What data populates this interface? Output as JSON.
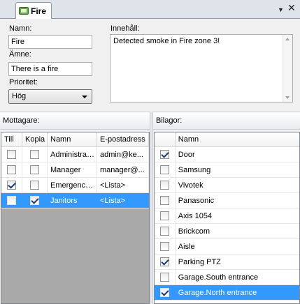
{
  "tab": {
    "title": "Fire",
    "menu_glyph": "▼",
    "close_glyph": "✕"
  },
  "form": {
    "name_label": "Namn:",
    "name_value": "Fire",
    "subject_label": "Ämne:",
    "subject_value": "There is a fire",
    "priority_label": "Prioritet:",
    "priority_value": "Hög",
    "content_label": "Innehåll:",
    "content_value": "Detected smoke in Fire zone 3!"
  },
  "recipients": {
    "title": "Mottagare:",
    "columns": [
      "Till",
      "Kopia",
      "Namn",
      "E-postadress"
    ],
    "rows": [
      {
        "till": false,
        "kopia": false,
        "name": "Administrator",
        "email": "admin@ke...",
        "selected": false
      },
      {
        "till": false,
        "kopia": false,
        "name": "Manager",
        "email": "manager@...",
        "selected": false
      },
      {
        "till": true,
        "kopia": false,
        "name": "Emergency...",
        "email": "<Lista>",
        "selected": false
      },
      {
        "till": false,
        "kopia": true,
        "name": "Janitors",
        "email": "<Lista>",
        "selected": true
      }
    ]
  },
  "attachments": {
    "title": "Bilagor:",
    "columns": [
      "Namn"
    ],
    "rows": [
      {
        "checked": true,
        "name": "Door",
        "selected": false
      },
      {
        "checked": false,
        "name": "Samsung",
        "selected": false
      },
      {
        "checked": false,
        "name": "Vivotek",
        "selected": false
      },
      {
        "checked": false,
        "name": "Panasonic",
        "selected": false
      },
      {
        "checked": false,
        "name": "Axis 1054",
        "selected": false
      },
      {
        "checked": false,
        "name": "Brickcom",
        "selected": false
      },
      {
        "checked": false,
        "name": "Aisle",
        "selected": false
      },
      {
        "checked": true,
        "name": "Parking PTZ",
        "selected": false
      },
      {
        "checked": false,
        "name": "Garage.South entrance",
        "selected": false
      },
      {
        "checked": true,
        "name": "Garage.North entrance",
        "selected": true
      }
    ]
  }
}
